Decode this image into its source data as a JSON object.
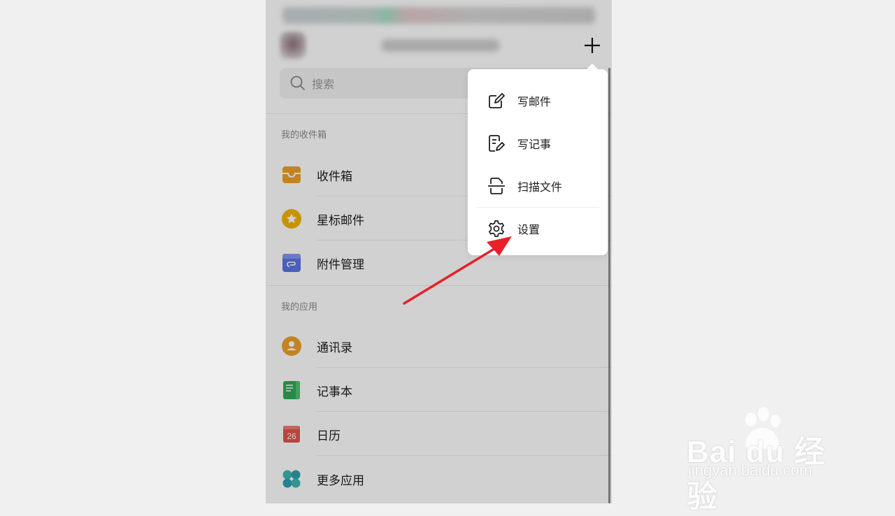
{
  "search": {
    "placeholder": "搜索"
  },
  "mailbox_section": {
    "label": "我的收件箱",
    "items": [
      {
        "label": "收件箱",
        "icon": "inbox-icon",
        "color": "#f0a029"
      },
      {
        "label": "星标邮件",
        "icon": "star-icon",
        "color": "#f5b400"
      },
      {
        "label": "附件管理",
        "icon": "attachment-icon",
        "color": "#5a74e6"
      }
    ]
  },
  "apps_section": {
    "label": "我的应用",
    "items": [
      {
        "label": "通讯录",
        "icon": "contacts-icon",
        "color": "#f0a029"
      },
      {
        "label": "记事本",
        "icon": "notebook-icon",
        "color": "#2eaa55"
      },
      {
        "label": "日历",
        "icon": "calendar-icon",
        "color": "#e0564e",
        "badge": "26"
      },
      {
        "label": "更多应用",
        "icon": "more-apps-icon",
        "color": "#3fb5b0"
      }
    ]
  },
  "popup_menu": {
    "items": [
      {
        "label": "写邮件",
        "icon": "compose-icon"
      },
      {
        "label": "写记事",
        "icon": "write-note-icon"
      },
      {
        "label": "扫描文件",
        "icon": "scan-icon"
      },
      {
        "label": "设置",
        "icon": "gear-icon"
      }
    ]
  },
  "watermark": {
    "brand": "Bai du 经验",
    "site": "jingyan.baidu.com"
  },
  "colors": {
    "annotation_arrow": "#e8202a",
    "overlay": "rgba(0,0,0,0.18)"
  }
}
